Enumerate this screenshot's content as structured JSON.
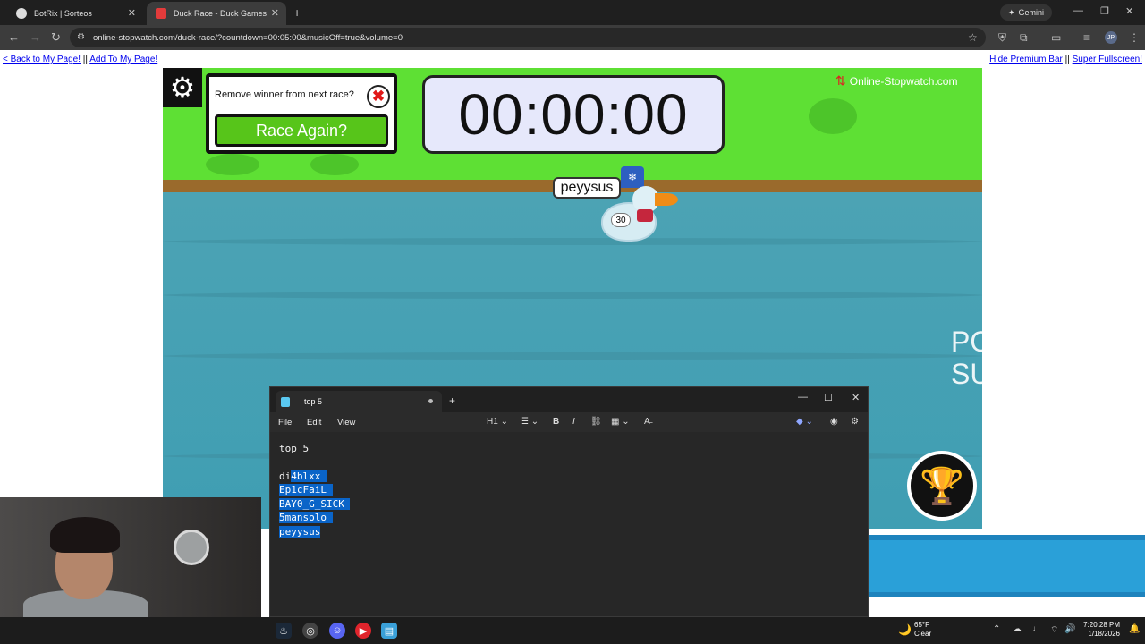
{
  "browser": {
    "tabs": [
      {
        "title": "BotRix | Sorteos"
      },
      {
        "title": "Duck Race - Duck Games"
      }
    ],
    "url": "online-stopwatch.com/duck-race/?countdown=00:05:00&musicOff=true&volume=0",
    "gemini_label": "Gemini",
    "profile_initials": "JP"
  },
  "page": {
    "back_link": "< Back to My Page!",
    "separator": "||",
    "add_link": "Add To My Page!",
    "hide_premium": "Hide Premium Bar",
    "super_fullscreen": "Super Fullscreen!"
  },
  "game": {
    "remove_winner_question": "Remove winner from next race?",
    "race_again": "Race Again?",
    "timer": "00:00:00",
    "brand": "Online-Stopwatch.com",
    "duck_name": "peyysus",
    "duck_number": "30",
    "side_text_1": "PO",
    "side_text_2": "SU"
  },
  "notepad": {
    "tab_title": "top 5",
    "menu": {
      "file": "File",
      "edit": "Edit",
      "view": "View"
    },
    "heading_style": "H1",
    "heading_line": "top 5",
    "lines": [
      {
        "pre": "di",
        "sel": "4blxx "
      },
      {
        "pre": "",
        "sel": "Ep1cFaiL "
      },
      {
        "pre": "",
        "sel": "BAY0_G_SICK "
      },
      {
        "pre": "",
        "sel": "5mansolo "
      },
      {
        "pre": "",
        "sel": "peyysus"
      }
    ]
  },
  "taskbar": {
    "weather_temp": "65°F",
    "weather_desc": "Clear",
    "time": "7:20:28 PM",
    "date": "1/18/2026"
  },
  "colors": {
    "grass": "#5ee034",
    "water": "#4ca3b4",
    "race_again_bg": "#57c51a",
    "selection": "#0a64c8"
  }
}
